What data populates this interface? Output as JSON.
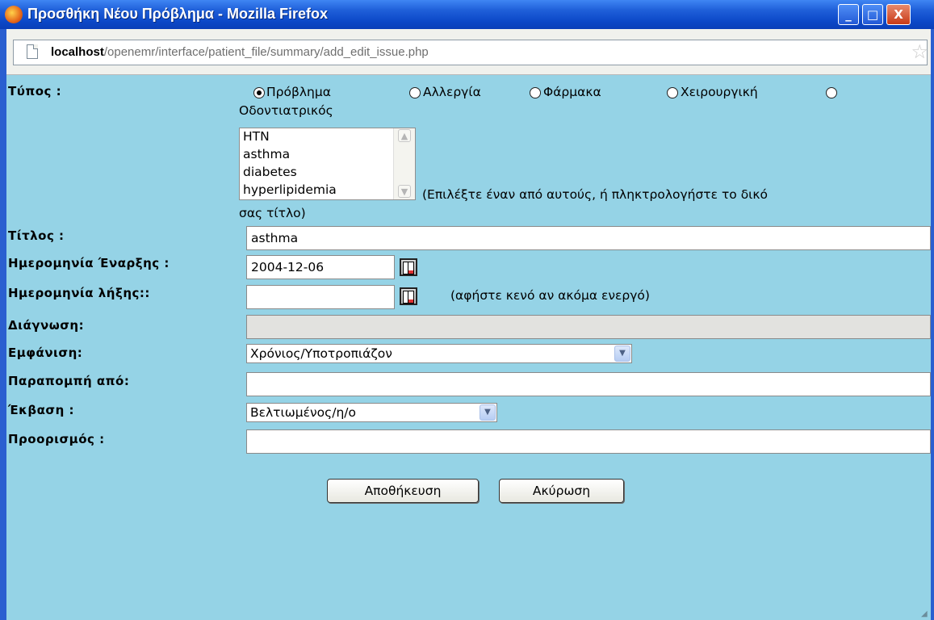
{
  "window": {
    "title": "Προσθήκη Νέου Πρόβλημα - Mozilla Firefox",
    "controls": {
      "minimize": "_",
      "maximize": "□",
      "close": "X"
    }
  },
  "urlbar": {
    "host": "localhost",
    "path": "/openemr/interface/patient_file/summary/add_edit_issue.php",
    "page_icon": "page-icon",
    "bookmark_icon": "star-icon"
  },
  "form": {
    "type": {
      "label": "Τύπος :",
      "options": [
        "Πρόβλημα",
        "Αλλεργία",
        "Φάρμακα",
        "Χειρουργική",
        "Οδοντιατρικός"
      ],
      "selected": "Πρόβλημα"
    },
    "list": {
      "items": [
        "HTN",
        "asthma",
        "diabetes",
        "hyperlipidemia"
      ],
      "hint_line1": "(Επιλέξτε έναν από αυτούς, ή πληκτρολογήστε το δικό",
      "hint_line2": "σας τίτλο)"
    },
    "title": {
      "label": "Τίτλος :",
      "value": "asthma"
    },
    "start_date": {
      "label": "Ημερομηνία Έναρξης :",
      "value": "2004-12-06"
    },
    "end_date": {
      "label": "Ημερομηνία λήξης::",
      "value": "",
      "hint": "(αφήστε κενό αν ακόμα ενεργό)"
    },
    "diagnosis": {
      "label": "Διάγνωση:",
      "value": ""
    },
    "occurrence": {
      "label": "Εμφάνιση:",
      "value": "Χρόνιος/Υποτροπιάζον"
    },
    "referred_by": {
      "label": "Παραπομπή από:",
      "value": ""
    },
    "outcome": {
      "label": "Έκβαση :",
      "value": "Βελτιωμένος/η/ο"
    },
    "destination": {
      "label": "Προορισμός :",
      "value": ""
    },
    "save_label": "Αποθήκευση",
    "cancel_label": "Ακύρωση"
  },
  "colors": {
    "titlebar": "#0b47c7",
    "page_background": "#95d3e6"
  }
}
